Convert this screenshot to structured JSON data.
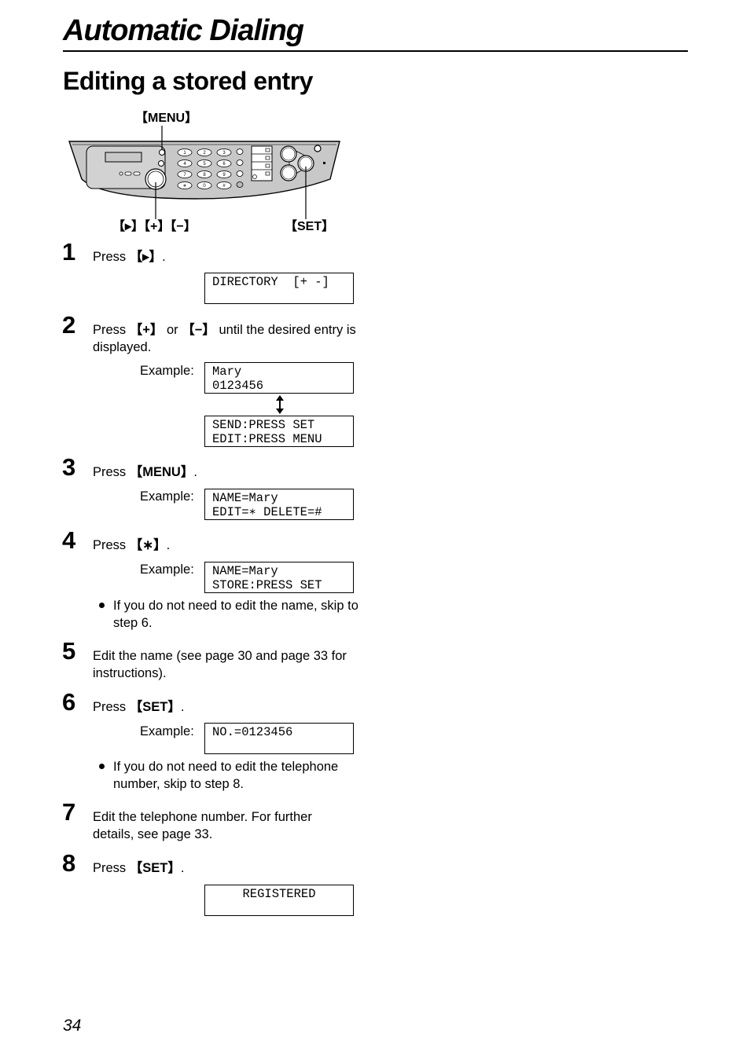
{
  "header": {
    "section_title": "Automatic Dialing",
    "page_heading": "Editing a stored entry"
  },
  "diagram": {
    "menu_label": "【MENU】",
    "nav_labels": "【▸】【+】【−】",
    "set_label": "【SET】",
    "keypad": [
      "1",
      "2",
      "3",
      "4",
      "5",
      "6",
      "7",
      "8",
      "9",
      "∗",
      "0",
      "#"
    ]
  },
  "steps": [
    {
      "number": "1",
      "text_prefix": "Press ",
      "key": "【▸】",
      "text_suffix": ".",
      "display": {
        "lines": [
          "DIRECTORY  [+ -]",
          ""
        ]
      }
    },
    {
      "number": "2",
      "text_prefix": "Press ",
      "key": "【+】",
      "text_mid": " or ",
      "key2": "【−】",
      "text_suffix": " until the desired entry is displayed.",
      "example_label": "Example:",
      "display": {
        "lines": [
          "Mary",
          "0123456"
        ]
      },
      "display_alt": {
        "lines": [
          "SEND:PRESS SET",
          "EDIT:PRESS MENU"
        ]
      },
      "toggle_icon": "updown-arrow-icon"
    },
    {
      "number": "3",
      "text_prefix": "Press ",
      "key": "【MENU】",
      "text_suffix": ".",
      "example_label": "Example:",
      "display": {
        "lines": [
          "NAME=Mary",
          "EDIT=∗ DELETE=#"
        ]
      }
    },
    {
      "number": "4",
      "text_prefix": "Press ",
      "key": "【∗】",
      "text_suffix": ".",
      "example_label": "Example:",
      "display": {
        "lines": [
          "NAME=Mary",
          "STORE:PRESS SET"
        ]
      },
      "bullet": "If you do not need to edit the name, skip to step 6."
    },
    {
      "number": "5",
      "text": "Edit the name (see page 30 and page 33 for instructions)."
    },
    {
      "number": "6",
      "text_prefix": "Press ",
      "key": "【SET】",
      "text_suffix": ".",
      "example_label": "Example:",
      "display": {
        "lines": [
          "NO.=0123456",
          ""
        ]
      },
      "bullet": "If you do not need to edit the telephone number, skip to step 8."
    },
    {
      "number": "7",
      "text": "Edit the telephone number. For further details, see page 33."
    },
    {
      "number": "8",
      "text_prefix": "Press ",
      "key": "【SET】",
      "text_suffix": ".",
      "display": {
        "lines": [
          "REGISTERED",
          ""
        ]
      }
    }
  ],
  "footer": {
    "page_number": "34"
  }
}
